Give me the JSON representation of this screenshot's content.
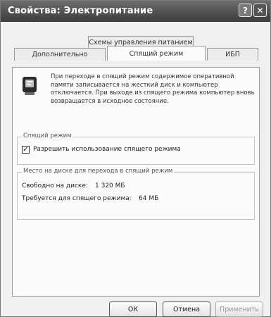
{
  "window": {
    "title": "Свойства: Электропитание"
  },
  "tabs": {
    "top": "Схемы управления питанием",
    "bottom": [
      "Дополнительно",
      "Спящий режим",
      "ИБП"
    ],
    "active": "Спящий режим"
  },
  "info": {
    "text": "При переходе в спящий режим содержимое оперативной памяти записывается на жесткий диск и компьютер отключается. При выходе из спящего режима компьютер вновь возвращается в исходное состояние."
  },
  "sleep_group": {
    "legend": "Спящий режим",
    "checkbox_label": "Разрешить использование спящего режима",
    "checked": true
  },
  "disk_group": {
    "legend": "Место на диске для перехода в спящий режим",
    "free_label": "Свободно на диске:",
    "free_value": "1 320 МБ",
    "required_label": "Требуется для спящего режима:",
    "required_value": "64 МБ"
  },
  "buttons": {
    "ok": "ОК",
    "cancel": "Отмена",
    "apply": "Применить"
  }
}
